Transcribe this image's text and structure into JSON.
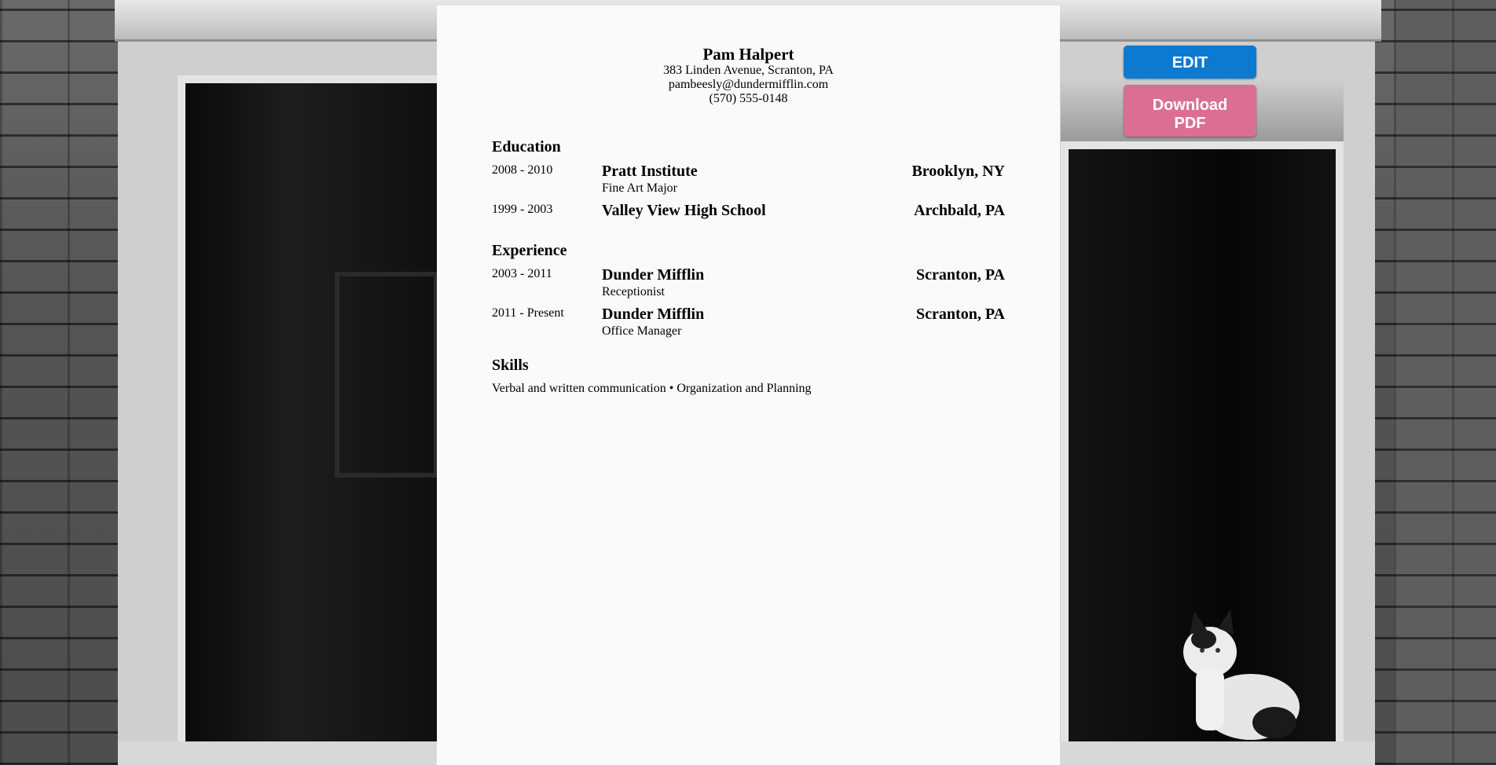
{
  "resume": {
    "name": "Pam Halpert",
    "address": "383 Linden Avenue, Scranton, PA",
    "email": "pambeesly@dundermifflin.com",
    "phone": "(570) 555-0148",
    "education": {
      "title": "Education",
      "entries": [
        {
          "dates": "2008 - 2010",
          "org": "Pratt Institute",
          "location": "Brooklyn, NY",
          "detail": "Fine Art Major"
        },
        {
          "dates": "1999 - 2003",
          "org": "Valley View High School",
          "location": "Archbald, PA",
          "detail": ""
        }
      ]
    },
    "experience": {
      "title": "Experience",
      "entries": [
        {
          "dates": "2003 - 2011",
          "org": "Dunder Mifflin",
          "location": "Scranton, PA",
          "detail": "Receptionist"
        },
        {
          "dates": "2011 - Present",
          "org": "Dunder Mifflin",
          "location": "Scranton, PA",
          "detail": "Office Manager"
        }
      ]
    },
    "skills": {
      "title": "Skills",
      "text": "Verbal and written communication • Organization and Planning"
    }
  },
  "actions": {
    "edit_label": "EDIT",
    "download_line1": "Download",
    "download_line2": "PDF",
    "edit_color": "#0d7ad1",
    "download_color": "#db6f93"
  }
}
